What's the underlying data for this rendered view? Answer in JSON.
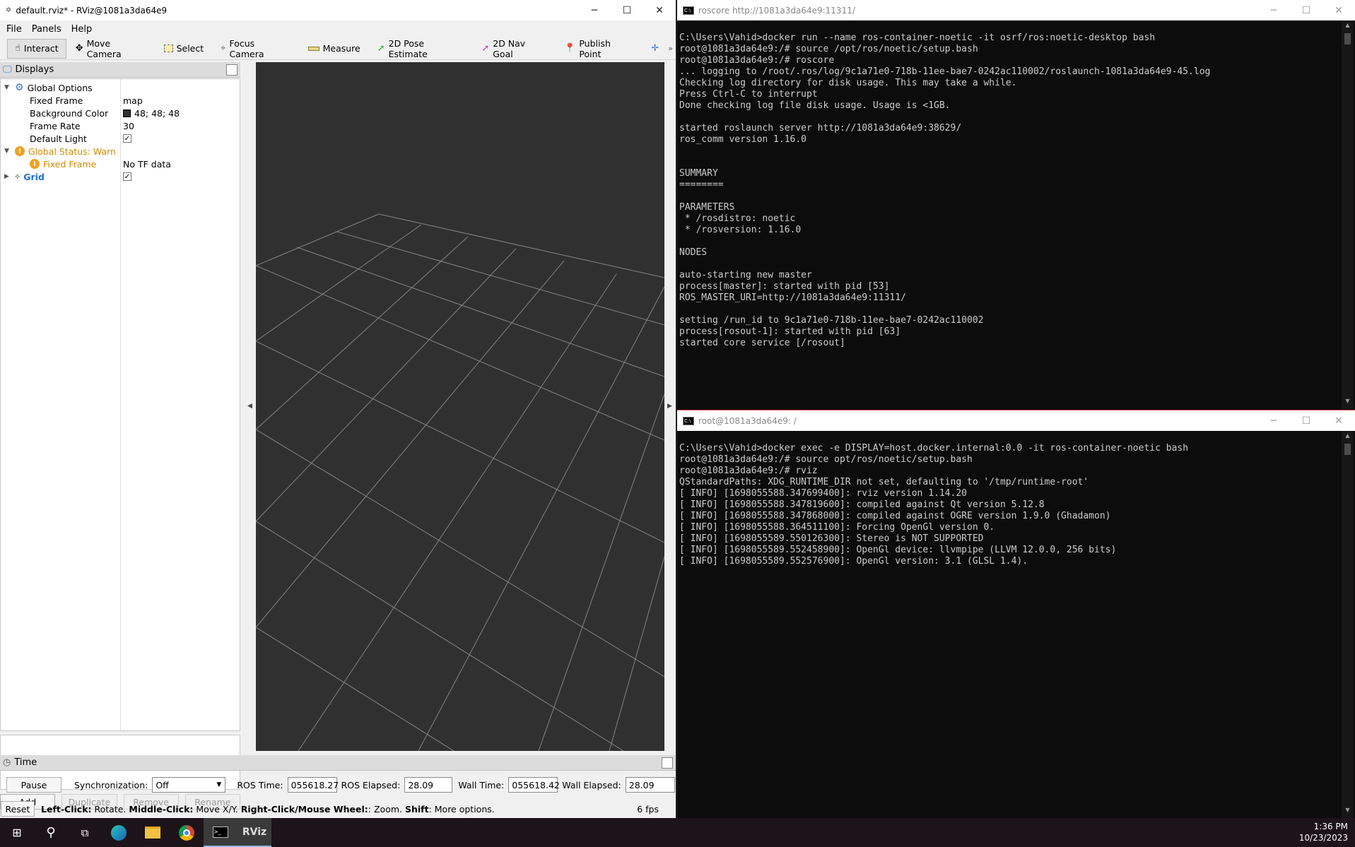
{
  "rviz": {
    "title": "default.rviz* - RViz@1081a3da64e9",
    "menu": [
      "File",
      "Panels",
      "Help"
    ],
    "tools": [
      {
        "label": "Interact",
        "icon": "hand-icon"
      },
      {
        "label": "Move Camera",
        "icon": "move-icon"
      },
      {
        "label": "Select",
        "icon": "select-icon"
      },
      {
        "label": "Focus Camera",
        "icon": "focus-icon"
      },
      {
        "label": "Measure",
        "icon": "ruler-icon"
      },
      {
        "label": "2D Pose Estimate",
        "icon": "arrow-green-icon"
      },
      {
        "label": "2D Nav Goal",
        "icon": "arrow-pink-icon"
      },
      {
        "label": "Publish Point",
        "icon": "pin-icon"
      }
    ],
    "displays": {
      "title": "Displays",
      "global_options": "Global Options",
      "fixed_frame_label": "Fixed Frame",
      "fixed_frame_value": "map",
      "bg_color_label": "Background Color",
      "bg_color_value": "48; 48; 48",
      "frame_rate_label": "Frame Rate",
      "frame_rate_value": "30",
      "default_light_label": "Default Light",
      "global_status": "Global Status: Warn",
      "status_fixed_frame": "Fixed Frame",
      "status_fixed_frame_value": "No TF data",
      "grid": "Grid",
      "buttons": {
        "add": "Add",
        "duplicate": "Duplicate",
        "remove": "Remove",
        "rename": "Rename"
      }
    },
    "time": {
      "title": "Time",
      "pause": "Pause",
      "sync_label": "Synchronization:",
      "sync_value": "Off",
      "ros_time_label": "ROS Time:",
      "ros_time": "055618.27",
      "ros_elapsed_label": "ROS Elapsed:",
      "ros_elapsed": "28.09",
      "wall_time_label": "Wall Time:",
      "wall_time": "055618.42",
      "wall_elapsed_label": "Wall Elapsed:",
      "wall_elapsed": "28.09"
    },
    "status": {
      "reset": "Reset",
      "hint_1b": "Left-Click:",
      "hint_1": " Rotate. ",
      "hint_2b": "Middle-Click:",
      "hint_2": " Move X/Y. ",
      "hint_3b": "Right-Click/Mouse Wheel:",
      "hint_3": ": Zoom. ",
      "hint_4b": "Shift",
      "hint_4": ": More options.",
      "fps": "6 fps"
    },
    "background_color": "#303030"
  },
  "term1": {
    "title": "roscore http://1081a3da64e9:11311/",
    "text": "C:\\Users\\Vahid>docker run --name ros-container-noetic -it osrf/ros:noetic-desktop bash\nroot@1081a3da64e9:/# source /opt/ros/noetic/setup.bash\nroot@1081a3da64e9:/# roscore\n... logging to /root/.ros/log/9c1a71e0-718b-11ee-bae7-0242ac110002/roslaunch-1081a3da64e9-45.log\nChecking log directory for disk usage. This may take a while.\nPress Ctrl-C to interrupt\nDone checking log file disk usage. Usage is <1GB.\n\nstarted roslaunch server http://1081a3da64e9:38629/\nros_comm version 1.16.0\n\n\nSUMMARY\n========\n\nPARAMETERS\n * /rosdistro: noetic\n * /rosversion: 1.16.0\n\nNODES\n\nauto-starting new master\nprocess[master]: started with pid [53]\nROS_MASTER_URI=http://1081a3da64e9:11311/\n\nsetting /run_id to 9c1a71e0-718b-11ee-bae7-0242ac110002\nprocess[rosout-1]: started with pid [63]\nstarted core service [/rosout]"
  },
  "term2": {
    "title": "root@1081a3da64e9: /",
    "text": "C:\\Users\\Vahid>docker exec -e DISPLAY=host.docker.internal:0.0 -it ros-container-noetic bash\nroot@1081a3da64e9:/# source opt/ros/noetic/setup.bash\nroot@1081a3da64e9:/# rviz\nQStandardPaths: XDG_RUNTIME_DIR not set, defaulting to '/tmp/runtime-root'\n[ INFO] [1698055588.347699400]: rviz version 1.14.20\n[ INFO] [1698055588.347819600]: compiled against Qt version 5.12.8\n[ INFO] [1698055588.347868000]: compiled against OGRE version 1.9.0 (Ghadamon)\n[ INFO] [1698055588.364511100]: Forcing OpenGl version 0.\n[ INFO] [1698055589.550126300]: Stereo is NOT SUPPORTED\n[ INFO] [1698055589.552458900]: OpenGl device: llvmpipe (LLVM 12.0.0, 256 bits)\n[ INFO] [1698055589.552576900]: OpenGl version: 3.1 (GLSL 1.4)."
  },
  "taskbar": {
    "time": "1:36 PM",
    "date": "10/23/2023",
    "rviz_label": "RViz"
  }
}
